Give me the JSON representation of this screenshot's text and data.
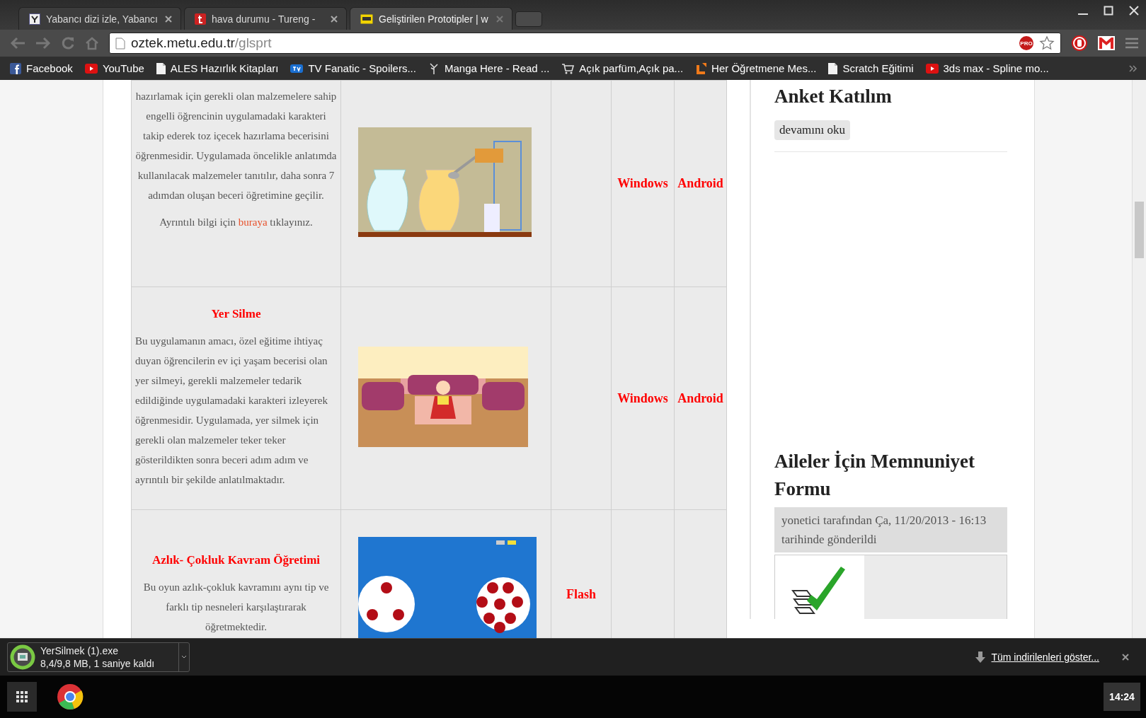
{
  "browser": {
    "tabs": [
      {
        "title": "Yabancı dizi izle, Yabancı",
        "selected": false
      },
      {
        "title": "hava durumu - Tureng -",
        "selected": false
      },
      {
        "title": "Geliştirilen Prototipler | w",
        "selected": true
      }
    ],
    "address": {
      "domain": "oztek.metu.edu.tr",
      "path": "/glsprt"
    },
    "extension_badge": "PRO",
    "bookmarks": [
      {
        "label": "Facebook"
      },
      {
        "label": "YouTube"
      },
      {
        "label": "ALES Hazırlık Kitapları"
      },
      {
        "label": "TV Fanatic - Spoilers..."
      },
      {
        "label": "Manga Here - Read ..."
      },
      {
        "label": "Açık parfüm,Açık pa..."
      },
      {
        "label": "Her Öğretmene Mes..."
      },
      {
        "label": "Scratch Eğitimi"
      },
      {
        "label": "3ds max - Spline mo..."
      }
    ]
  },
  "table": {
    "rows": [
      {
        "description": "hazırlamak için gerekli olan malzemelere sahip engelli öğrencinin uygulamadaki karakteri takip ederek toz içecek hazırlama becerisini öğrenmesidir. Uygulamada öncelikle anlatımda kullanılacak malzemeler tanıtılır, daha sonra 7 adımdan oluşan beceri öğretimine geçilir.",
        "more_before": "Ayrıntılı bilgi için ",
        "more_link": "buraya",
        "more_after": " tıklayınız.",
        "cell_4": "Windows",
        "cell_5": "Android"
      },
      {
        "title": "Yer Silme",
        "description": "Bu uygulamanın amacı, özel eğitime ihtiyaç duyan öğrencilerin ev içi yaşam becerisi olan yer silmeyi, gerekli malzemeler tedarik edildiğinde uygulamadaki karakteri izleyerek öğrenmesidir. Uygulamada, yer silmek için gerekli olan malzemeler teker teker gösterildikten sonra beceri adım adım ve ayrıntılı bir şekilde anlatılmaktadır.",
        "cell_4": "Windows",
        "cell_5": "Android"
      },
      {
        "title": "Azlık- Çokluk Kavram Öğretimi",
        "description": "Bu oyun azlık-çokluk kavramını aynı tip ve farklı tip nesneleri karşılaştırarak öğretmektedir.",
        "cell_3": "Flash"
      }
    ]
  },
  "sidebar": {
    "poll": {
      "title": "Anket Katılım",
      "button": "devamını oku"
    },
    "post": {
      "title": "Aileler İçin Memnuniyet Formu",
      "meta": "yonetici tarafından Ça, 11/20/2013 - 16:13 tarihinde gönderildi"
    }
  },
  "download_bar": {
    "file": "YerSilmek (1).exe",
    "progress": "8,4/9,8 MB, 1 saniye kaldı",
    "show_all": "Tüm indirilenleri göster..."
  },
  "taskbar": {
    "clock": "14:24"
  }
}
